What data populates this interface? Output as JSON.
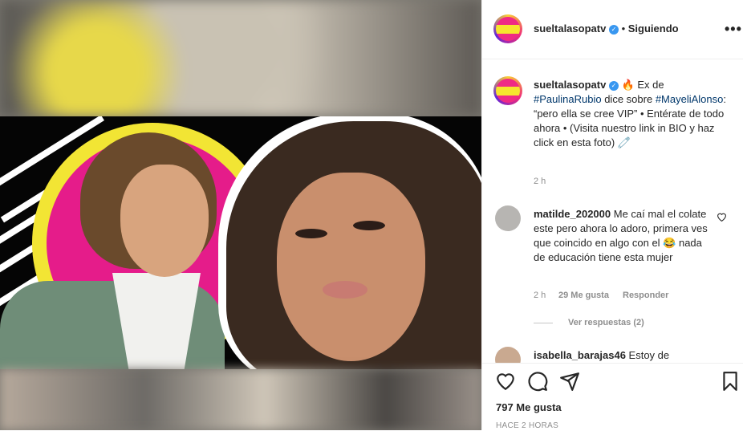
{
  "post": {
    "username": "sueltalasopatv",
    "follow_status": "Siguiendo",
    "more_icon": "more-options-icon",
    "caption_emoji": "🔥",
    "caption_part1": "Ex de",
    "hashtag1": "#PaulinaRubio",
    "caption_part2": "dice sobre",
    "hashtag2": "#MayeliAlonso",
    "caption_part3": ": “pero ella se cree VIP” • Entérate de todo ahora • (Visita nuestro link in BIO y haz click en esta foto) 🧷",
    "caption_time": "2 h"
  },
  "comments": [
    {
      "username": "matilde_202000",
      "text": "Me caí mal el colate este pero ahora lo adoro, primera ves que coincido en algo con el 😂 nada de educación tiene esta mujer",
      "time": "2 h",
      "likes": "29 Me gusta",
      "reply_label": "Responder",
      "view_replies": "Ver respuestas (2)"
    },
    {
      "username": "isabella_barajas46",
      "text": "Estoy de"
    }
  ],
  "actions": {
    "likes": "797 Me gusta",
    "posted_ago": "HACE 2 HORAS"
  }
}
